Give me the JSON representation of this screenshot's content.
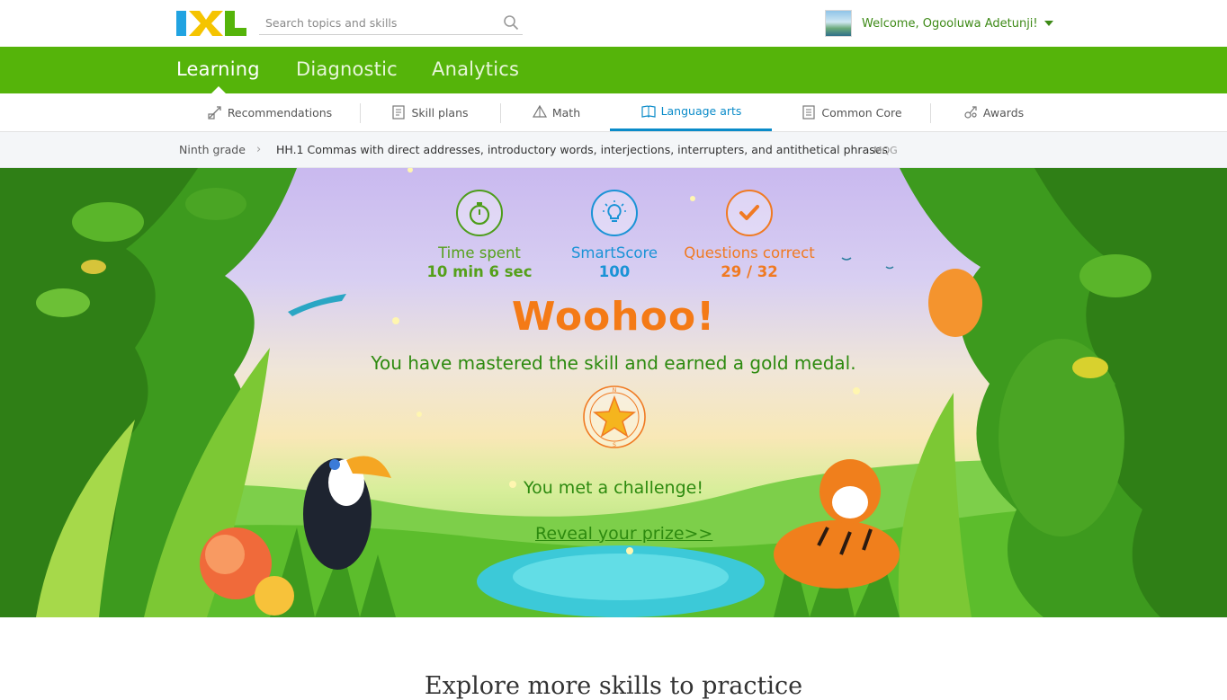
{
  "header": {
    "logo_text": "IXL",
    "search": {
      "placeholder": "Search topics and skills",
      "value": ""
    },
    "welcome": "Welcome, Ogooluwa Adetunji!"
  },
  "main_nav": {
    "tabs": [
      {
        "label": "Learning",
        "active": true
      },
      {
        "label": "Diagnostic",
        "active": false
      },
      {
        "label": "Analytics",
        "active": false
      }
    ]
  },
  "sub_nav": {
    "tabs": [
      {
        "label": "Recommendations",
        "icon": "recommendations-icon",
        "active": false
      },
      {
        "label": "Skill plans",
        "icon": "skill-plans-icon",
        "active": false
      },
      {
        "label": "Math",
        "icon": "math-icon",
        "active": false
      },
      {
        "label": "Language arts",
        "icon": "language-arts-icon",
        "active": true
      },
      {
        "label": "Common Core",
        "icon": "common-core-icon",
        "active": false
      },
      {
        "label": "Awards",
        "icon": "awards-icon",
        "active": false
      }
    ]
  },
  "breadcrumb": {
    "grade": "Ninth grade",
    "separator": "›",
    "skill": "HH.1 Commas with direct addresses, introductory words, interjections, interrupters, and antithetical phrases",
    "code": "MQG"
  },
  "results": {
    "time_spent_label": "Time spent",
    "time_spent_value": "10 min 6 sec",
    "smartscore_label": "SmartScore",
    "smartscore_value": "100",
    "questions_label": "Questions correct",
    "questions_value": "29 / 32",
    "headline": "Woohoo!",
    "message": "You have mastered the skill and earned a gold medal.",
    "challenge": "You met a challenge!",
    "prize_link": "Reveal your prize>>"
  },
  "explore": {
    "heading": "Explore more skills to practice"
  },
  "colors": {
    "brand_green": "#55b40a",
    "accent_blue": "#0a8bc9",
    "orange": "#f47a16",
    "text_green": "#2d8a0f"
  }
}
